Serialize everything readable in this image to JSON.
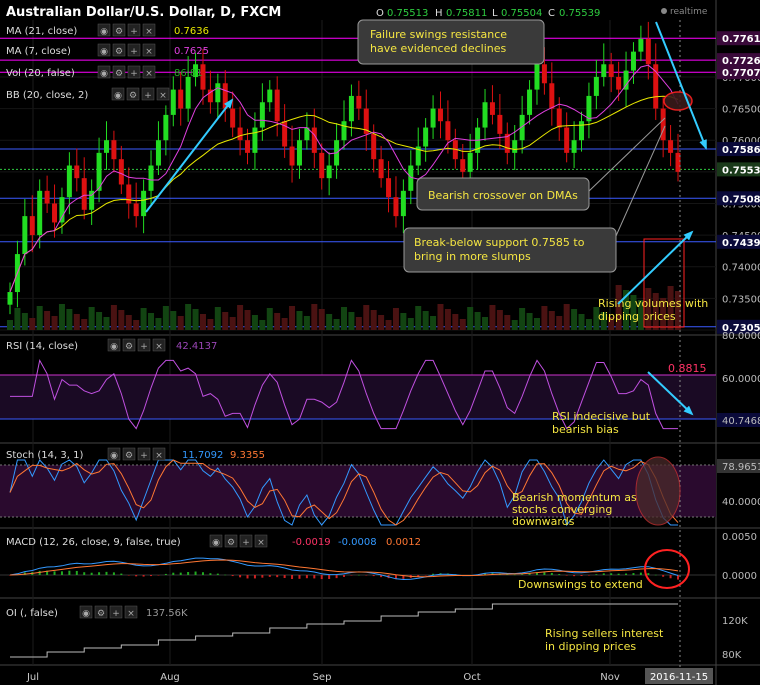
{
  "header": {
    "title": "Australian Dollar/U.S. Dollar, D, FXCM",
    "o_label": "O",
    "o_value": "0.75513",
    "h_label": "H",
    "h_value": "0.75811",
    "l_label": "L",
    "l_value": "0.75504",
    "c_label": "C",
    "c_value": "0.75539",
    "realtime": "realtime"
  },
  "studies": {
    "ma21": {
      "label": "MA (21, close)",
      "value": "0.7636"
    },
    "ma7": {
      "label": "MA (7, close)",
      "value": "0.7625"
    },
    "vol": {
      "label": "Vol (20, false)",
      "value": "86.81"
    },
    "bb": {
      "label": "BB (20, close, 2)"
    }
  },
  "price_axis": {
    "ticks": [
      "0.73000",
      "0.73500",
      "0.74000",
      "0.74500",
      "0.75000",
      "0.75500",
      "0.76000",
      "0.76500",
      "0.77000"
    ],
    "hlines": [
      {
        "label": "0.77612",
        "color": "#ff00ff"
      },
      {
        "label": "0.77266",
        "color": "#ff00ff"
      },
      {
        "label": "0.77075",
        "color": "#ff00ff"
      },
      {
        "label": "0.75860",
        "color": "#3b5bff"
      },
      {
        "label": "0.75539",
        "color": "#2ecc40"
      },
      {
        "label": "0.75082",
        "color": "#3b5bff"
      },
      {
        "label": "0.74394",
        "color": "#3b5bff"
      },
      {
        "label": "0.73051",
        "color": "#3b5bff"
      }
    ]
  },
  "rsi": {
    "label": "RSI (14, close)",
    "value": "42.4137",
    "ticks": [
      "80.0000",
      "60.0000",
      "40.7468"
    ],
    "marker": "0.8815"
  },
  "stoch": {
    "label": "Stoch (14, 3, 1)",
    "k": "11.7092",
    "d": "9.3355",
    "ticks": [
      "78.9651",
      "40.0000"
    ]
  },
  "macd": {
    "label": "MACD (12, 26, close, 9, false, true)",
    "v1": "-0.0019",
    "v2": "-0.0008",
    "v3": "0.0012",
    "ticks": [
      "0.0050",
      "0.0000"
    ]
  },
  "oi": {
    "label": "OI (, false)",
    "value": "137.56K",
    "ticks": [
      "120K",
      "80K"
    ]
  },
  "x_axis": {
    "labels": [
      "Jul",
      "Aug",
      "Sep",
      "Oct",
      "Nov"
    ],
    "current": "2016-11-15"
  },
  "annotations": {
    "failure": "Failure swings resistance have evidenced declines",
    "crossover": "Bearish crossover on DMAs",
    "breakbelow": "Break-below support 0.7585 to bring in more slumps",
    "volumes": "Rising volumes with dipping prices",
    "rsi": "RSI indecisive but bearish bias",
    "stoch": "Bearish momentum as stochs converging downwards",
    "macd": "Downswings to extend",
    "oi": "Rising sellers interest in dipping prices"
  },
  "colors": {
    "up": "#22dd22",
    "down": "#dd1111",
    "ma21": "#e8e800",
    "ma7": "#e040e0",
    "arrow": "#33ccff"
  },
  "chart_data": {
    "type": "candlestick",
    "symbol": "AUD/USD",
    "timeframe": "D",
    "x_range": [
      "2016-06-23",
      "2016-11-15"
    ],
    "y_range": [
      0.73,
      0.779
    ],
    "ohlc_close_approx": [
      0.736,
      0.742,
      0.748,
      0.745,
      0.752,
      0.75,
      0.747,
      0.751,
      0.756,
      0.754,
      0.749,
      0.752,
      0.758,
      0.76,
      0.757,
      0.753,
      0.75,
      0.748,
      0.752,
      0.756,
      0.76,
      0.764,
      0.768,
      0.765,
      0.77,
      0.772,
      0.768,
      0.766,
      0.769,
      0.765,
      0.762,
      0.76,
      0.758,
      0.762,
      0.766,
      0.768,
      0.763,
      0.759,
      0.756,
      0.76,
      0.762,
      0.758,
      0.754,
      0.756,
      0.76,
      0.763,
      0.767,
      0.765,
      0.761,
      0.757,
      0.754,
      0.751,
      0.748,
      0.752,
      0.756,
      0.759,
      0.762,
      0.765,
      0.763,
      0.76,
      0.757,
      0.755,
      0.758,
      0.762,
      0.766,
      0.764,
      0.761,
      0.758,
      0.76,
      0.764,
      0.768,
      0.772,
      0.769,
      0.765,
      0.762,
      0.758,
      0.76,
      0.763,
      0.767,
      0.77,
      0.772,
      0.77,
      0.768,
      0.771,
      0.774,
      0.776,
      0.772,
      0.765,
      0.76,
      0.758,
      0.755
    ]
  }
}
